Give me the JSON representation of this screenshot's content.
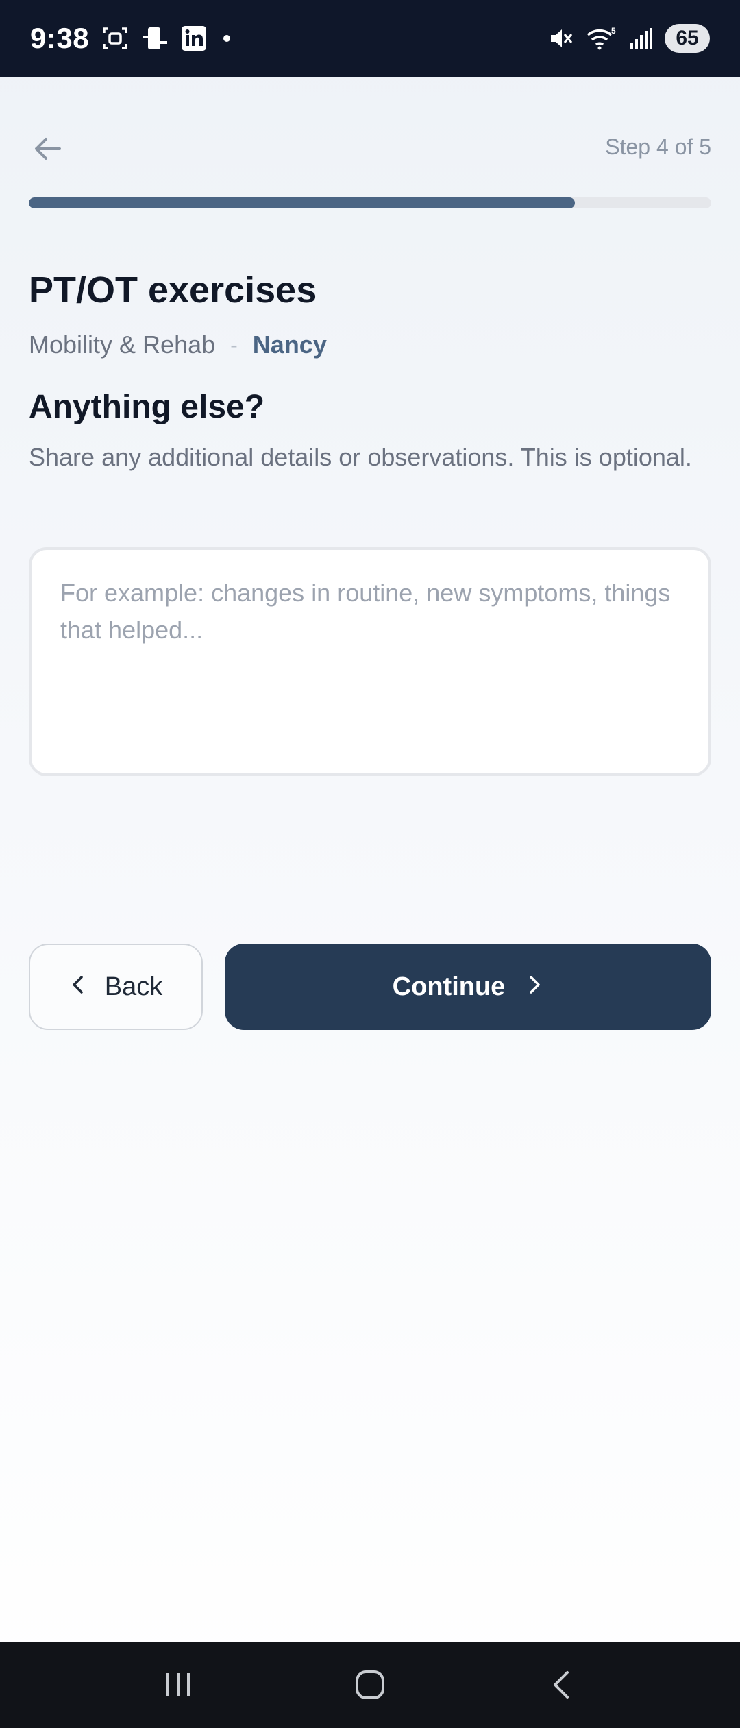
{
  "status_bar": {
    "time": "9:38",
    "battery": "65",
    "wifi_badge": "5",
    "left_icons": [
      "screenshot-icon",
      "device-icon",
      "linkedin-icon",
      "dot-icon"
    ],
    "right_icons": [
      "mute-icon",
      "wifi-icon",
      "signal-icon",
      "battery-icon"
    ]
  },
  "header": {
    "back_icon": "arrow-left-icon",
    "step_label": "Step 4 of 5",
    "progress": 0.8,
    "progress_color": "#4b6584"
  },
  "page": {
    "title": "PT/OT exercises",
    "category": "Mobility & Rehab",
    "separator": "-",
    "person": "Nancy"
  },
  "question": {
    "title": "Anything else?",
    "description": "Share any additional details or observations. This is optional.",
    "value": "",
    "placeholder": "For example: changes in routine, new symptoms, things that helped..."
  },
  "actions": {
    "back_label": "Back",
    "continue_label": "Continue",
    "continue_color": "#263b55"
  },
  "nav_bar": {
    "icons": [
      "recent-apps-icon",
      "home-icon",
      "system-back-icon"
    ]
  }
}
